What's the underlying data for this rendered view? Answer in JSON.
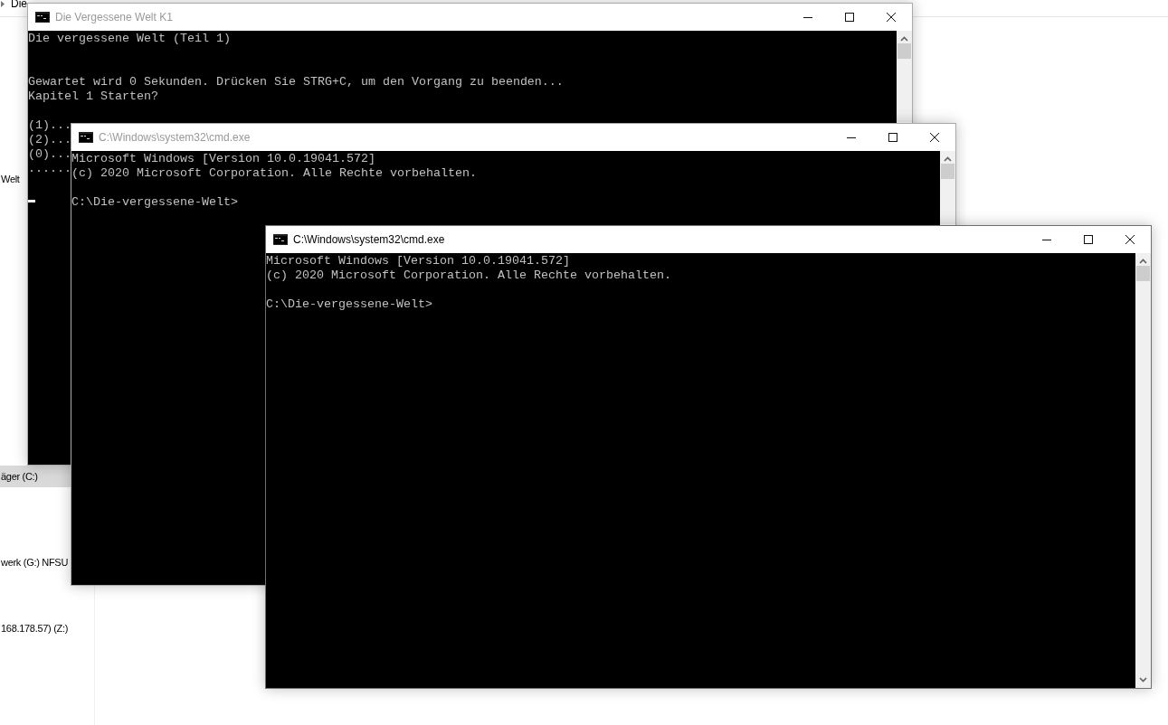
{
  "explorer": {
    "breadcrumb": "Die",
    "nav_items": [
      {
        "label": "Welt",
        "selected": false
      },
      {
        "label": "äger (C:)",
        "selected": true
      },
      {
        "label": "werk (G:) NFSU",
        "selected": false
      },
      {
        "label": "168.178.57) (Z:)",
        "selected": false
      }
    ]
  },
  "windows": [
    {
      "title": "Die Vergessene Welt K1",
      "active": false,
      "lines": [
        {
          "kind": "text",
          "text": "Die vergessene Welt (Teil 1)"
        },
        {
          "kind": "blank"
        },
        {
          "kind": "blank"
        },
        {
          "kind": "text",
          "text": "Gewartet wird 0 Sekunden. Drücken Sie STRG+C, um den Vorgang zu beenden..."
        },
        {
          "kind": "text",
          "text": "Kapitel 1 Starten?"
        },
        {
          "kind": "blank"
        },
        {
          "kind": "text",
          "text": "(1)..."
        },
        {
          "kind": "text",
          "text": "(2)..."
        },
        {
          "kind": "text",
          "text": "(0)..."
        },
        {
          "kind": "text",
          "text": "......"
        },
        {
          "kind": "blank"
        },
        {
          "kind": "cursor"
        }
      ]
    },
    {
      "title": "C:\\Windows\\system32\\cmd.exe",
      "active": false,
      "lines": [
        {
          "kind": "text",
          "text": "Microsoft Windows [Version 10.0.19041.572]"
        },
        {
          "kind": "text",
          "text": "(c) 2020 Microsoft Corporation. Alle Rechte vorbehalten."
        },
        {
          "kind": "blank"
        },
        {
          "kind": "text",
          "text": "C:\\Die-vergessene-Welt>"
        }
      ]
    },
    {
      "title": "C:\\Windows\\system32\\cmd.exe",
      "active": true,
      "lines": [
        {
          "kind": "text",
          "text": "Microsoft Windows [Version 10.0.19041.572]"
        },
        {
          "kind": "text",
          "text": "(c) 2020 Microsoft Corporation. Alle Rechte vorbehalten."
        },
        {
          "kind": "blank"
        },
        {
          "kind": "text",
          "text": "C:\\Die-vergessene-Welt>"
        }
      ]
    }
  ]
}
